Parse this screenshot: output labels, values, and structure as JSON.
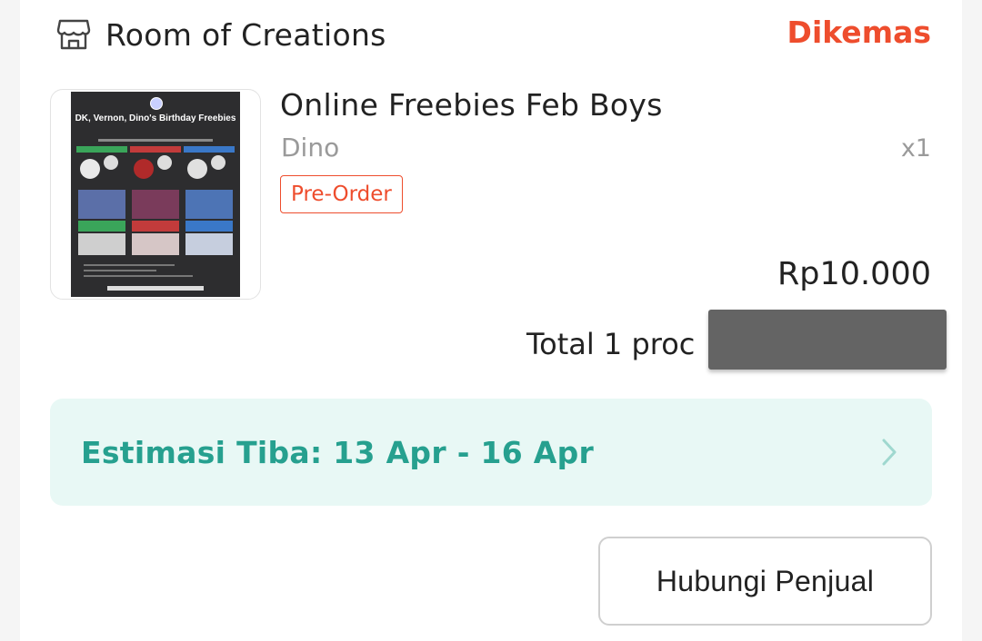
{
  "shop": {
    "name": "Room of Creations",
    "icon": "store-icon",
    "status": "Dikemas"
  },
  "product": {
    "image_icon": "product-poster-image",
    "poster_title": "DK, Vernon, Dino's Birthday Freebies",
    "title": "Online Freebies Feb Boys",
    "variant": "Dino",
    "quantity": "x1",
    "tag": "Pre-Order",
    "price": "Rp10.000"
  },
  "order": {
    "total_text": "Total 1 proc"
  },
  "delivery": {
    "estimate": "Estimasi Tiba: 13 Apr - 16 Apr",
    "chevron_icon": "chevron-right-icon"
  },
  "actions": {
    "contact_seller": "Hubungi Penjual"
  },
  "colors": {
    "accent": "#ee4d2d",
    "eta_text": "#26a08f",
    "eta_bg": "#e8f8f5"
  }
}
